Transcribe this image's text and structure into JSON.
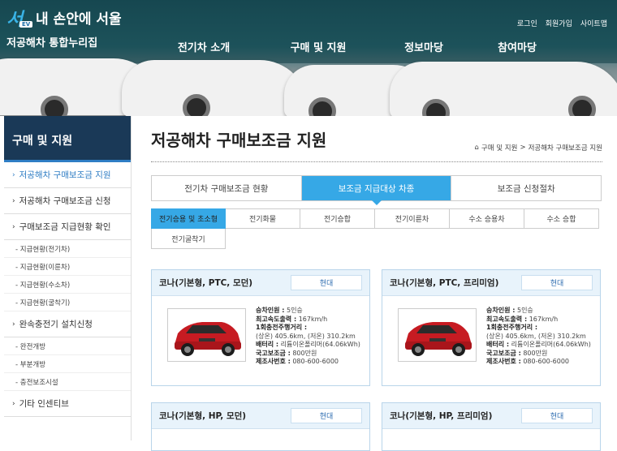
{
  "header": {
    "logo_text": "내 손안에 서울",
    "logo_badge": "EV",
    "site_title": "저공해차 통합누리집",
    "util_links": [
      "로그인",
      "회원가입",
      "사이트맵"
    ],
    "gnb": [
      "전기차 소개",
      "구매 및 지원",
      "정보마당",
      "참여마당"
    ]
  },
  "sidebar": {
    "title": "구매 및 지원",
    "items": [
      {
        "label": "저공해차 구매보조금 지원",
        "active": true
      },
      {
        "label": "저공해차 구매보조금 신청"
      },
      {
        "label": "구매보조금 지급현황 확인",
        "subs": [
          "- 지급현황(전기차)",
          "- 지급현황(이륜차)",
          "- 지급현황(수소차)",
          "- 지급현황(굴착기)"
        ]
      },
      {
        "label": "완속충전기 설치신청",
        "subs": [
          "- 완전개방",
          "- 부분개방",
          "- 충전보조시설"
        ]
      },
      {
        "label": "기타 인센티브"
      }
    ]
  },
  "main": {
    "page_title": "저공해차 구매보조금 지원",
    "breadcrumb": [
      "구매 및 지원",
      "저공해차 구매보조금 지원"
    ],
    "tabs": [
      "전기차 구매보조금 현황",
      "보조금 지급대상 차종",
      "보조금 신청절차"
    ],
    "active_tab": 1,
    "subtabs_row1": [
      "전기승용 및 초소형",
      "전기화물",
      "전기승합",
      "전기이륜차",
      "수소 승용차",
      "수소 승합"
    ],
    "subtabs_row2": [
      "전기굴착기"
    ],
    "active_subtab": 0,
    "cards": [
      {
        "name": "코나(기본형, PTC, 모던)",
        "maker": "현대",
        "specs": [
          {
            "k": "승차인원 :",
            "v": "5인승"
          },
          {
            "k": "최고속도출력 :",
            "v": "167km/h"
          },
          {
            "k": "1회충전주행거리 :",
            "v": ""
          },
          {
            "k": "",
            "v": "(상온) 405.6km, (저온) 310.2km"
          },
          {
            "k": "배터리 :",
            "v": "리튬이온폴리머(64.06kWh)"
          },
          {
            "k": "국고보조금 :",
            "v": "800만원"
          },
          {
            "k": "제조사번호 :",
            "v": "080-600-6000"
          }
        ]
      },
      {
        "name": "코나(기본형, PTC, 프리미엄)",
        "maker": "현대",
        "specs": [
          {
            "k": "승차인원 :",
            "v": "5인승"
          },
          {
            "k": "최고속도출력 :",
            "v": "167km/h"
          },
          {
            "k": "1회충전주행거리 :",
            "v": ""
          },
          {
            "k": "",
            "v": "(상온) 405.6km, (저온) 310.2km"
          },
          {
            "k": "배터리 :",
            "v": "리튬이온폴리머(64.06kWh)"
          },
          {
            "k": "국고보조금 :",
            "v": "800만원"
          },
          {
            "k": "제조사번호 :",
            "v": "080-600-6000"
          }
        ]
      },
      {
        "name": "코나(기본형, HP, 모던)",
        "maker": "현대"
      },
      {
        "name": "코나(기본형, HP, 프리미엄)",
        "maker": "현대"
      }
    ]
  },
  "colors": {
    "accent": "#36a8e6",
    "sidebar_title": "#1a3957",
    "card_border": "#b9d5ea"
  }
}
